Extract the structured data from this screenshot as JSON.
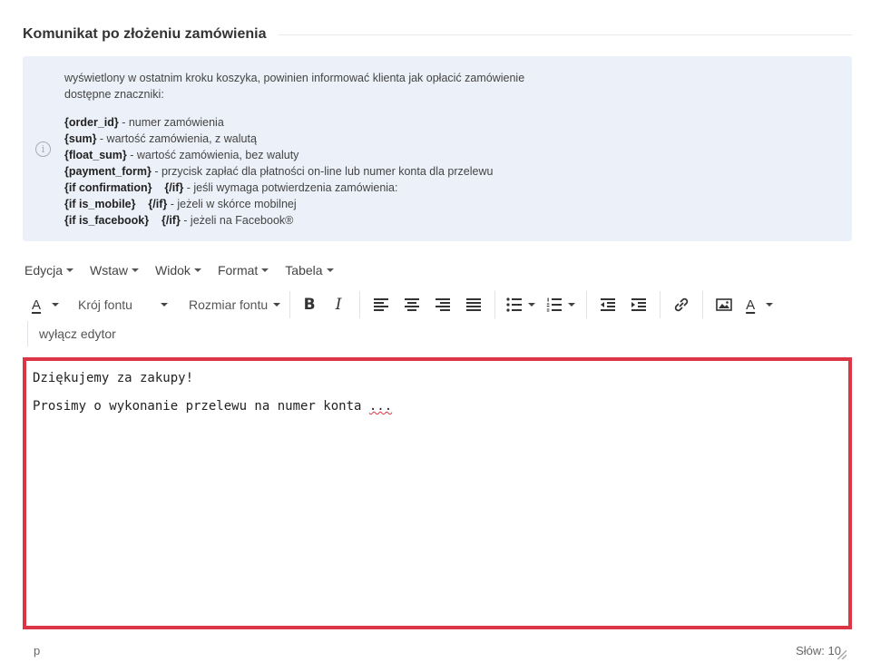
{
  "section": {
    "title": "Komunikat po złożeniu zamówienia"
  },
  "info": {
    "line1": "wyświetlony w ostatnim kroku koszyka, powinien informować klienta jak opłacić zamówienie",
    "line2": "dostępne znaczniki:",
    "tags": [
      {
        "tag": "{order_id}",
        "desc": " - numer zamówienia"
      },
      {
        "tag": "{sum}",
        "desc": " - wartość zamówienia, z walutą"
      },
      {
        "tag": "{float_sum}",
        "desc": " - wartość zamówienia, bez waluty"
      },
      {
        "tag": "{payment_form}",
        "desc": " - przycisk zapłać dla płatności on-line lub numer konta dla przelewu"
      },
      {
        "tag": "{if confirmation}    {/if}",
        "desc": " - jeśli wymaga potwierdzenia zamówienia:"
      },
      {
        "tag": "{if is_mobile}    {/if}",
        "desc": " - jeżeli w skórce mobilnej"
      },
      {
        "tag": "{if is_facebook}    {/if}",
        "desc": " - jeżeli na Facebook®"
      }
    ]
  },
  "menubar": {
    "edit": "Edycja",
    "insert": "Wstaw",
    "view": "Widok",
    "format": "Format",
    "table": "Tabela"
  },
  "toolbar": {
    "font_color_glyph": "A",
    "font_family": "Krój fontu",
    "font_size": "Rozmiar fontu",
    "bold_glyph": "B",
    "italic_glyph": "I",
    "text_color_glyph": "A",
    "disable_editor": "wyłącz edytor"
  },
  "editor": {
    "line1": "Dziękujemy za zakupy!",
    "line2_text": "Prosimy o wykonanie przelewu na numer konta ",
    "line2_spell": "..."
  },
  "status": {
    "path": "p",
    "word_count": "Słów: 10"
  },
  "colors": {
    "highlight_border": "#dc3545",
    "info_bg": "#ecf0f8"
  }
}
